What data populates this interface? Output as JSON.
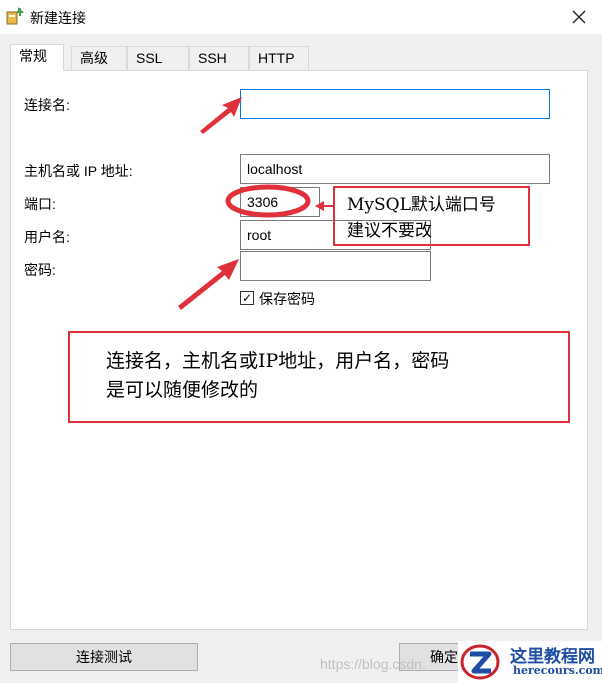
{
  "window": {
    "title": "新建连接"
  },
  "tabs": [
    {
      "label": "常规"
    },
    {
      "label": "高级"
    },
    {
      "label": "SSL"
    },
    {
      "label": "SSH"
    },
    {
      "label": "HTTP"
    }
  ],
  "form": {
    "connection_name": {
      "label": "连接名:",
      "value": ""
    },
    "host": {
      "label": "主机名或 IP 地址:",
      "value": "localhost"
    },
    "port": {
      "label": "端口:",
      "value": "3306"
    },
    "username": {
      "label": "用户名:",
      "value": "root"
    },
    "password": {
      "label": "密码:",
      "value": ""
    },
    "save_password": {
      "label": "保存密码",
      "checked": true
    }
  },
  "annotations": {
    "port_note": [
      "MySQL默认端口号",
      "建议不要改"
    ],
    "fields_note": [
      "连接名，主机名或IP地址，用户名，密码",
      "是可以随便修改的"
    ],
    "color": "#e0303a"
  },
  "footer": {
    "test_button": "连接测试",
    "ok_button": "确定"
  },
  "watermark": {
    "text": "https://blog.csdn.",
    "brand_name": "这里教程网",
    "brand_url": "herecours.com"
  },
  "colors": {
    "focus_border": "#0078d7",
    "dialog_bg": "#f0f0f0",
    "brand_blue": "#1f4da3",
    "brand_red": "#c8222b"
  }
}
